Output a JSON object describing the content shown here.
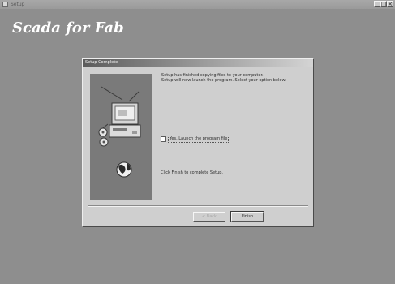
{
  "app": {
    "window_title": "Setup",
    "heading": "Scada for Fab",
    "controls": {
      "minimize": "_",
      "maximize": "□",
      "close": "×"
    }
  },
  "dialog": {
    "title": "Setup Complete",
    "info_lines": [
      "Setup has finished copying files to your computer.",
      "Setup will now launch the program. Select your option below."
    ],
    "checkbox": {
      "label": "Yes, Launch the program file",
      "checked": false
    },
    "finish_instruction": "Click Finish to complete Setup.",
    "buttons": {
      "back": "< Back",
      "finish": "Finish"
    }
  },
  "colors": {
    "desktop": "#8e8e8e",
    "dialog": "#cfcfcf",
    "graphic_panel": "#7a7a7a"
  },
  "icons": {
    "graphic": "computer-with-disks-and-globe-icon"
  }
}
